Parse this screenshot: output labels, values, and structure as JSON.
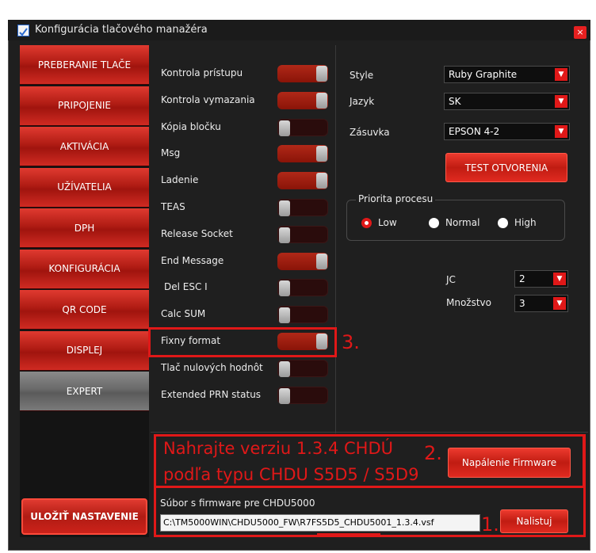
{
  "window": {
    "title": "Konfigurácia tlačového manažéra",
    "close_label": "×"
  },
  "nav": {
    "items": [
      {
        "label": "PREBERANIE TLAČE"
      },
      {
        "label": "PRIPOJENIE"
      },
      {
        "label": "AKTIVÁCIA"
      },
      {
        "label": "UŽÍVATELIA"
      },
      {
        "label": "DPH"
      },
      {
        "label": "KONFIGURÁCIA"
      },
      {
        "label": "QR CODE"
      },
      {
        "label": "DISPLEJ"
      },
      {
        "label": "EXPERT",
        "active": true
      }
    ],
    "save_label": "ULOŽIŤ NASTAVENIE"
  },
  "toggles": [
    {
      "label": "Kontrola prístupu",
      "on": true
    },
    {
      "label": "Kontrola vymazania",
      "on": true
    },
    {
      "label": "Kópia bločku",
      "on": false
    },
    {
      "label": "Msg",
      "on": true
    },
    {
      "label": "Ladenie",
      "on": true
    },
    {
      "label": "TEAS",
      "on": false
    },
    {
      "label": "Release Socket",
      "on": false
    },
    {
      "label": "End Message",
      "on": true
    },
    {
      "label": "Del ESC I",
      "on": false
    },
    {
      "label": "Calc SUM",
      "on": false
    },
    {
      "label": "Fixny format",
      "on": true
    },
    {
      "label": "Tlač nulových hodnôt",
      "on": false
    },
    {
      "label": "Extended PRN status",
      "on": false
    }
  ],
  "settings": {
    "style_label": "Style",
    "style_value": "Ruby Graphite",
    "jazyk_label": "Jazyk",
    "jazyk_value": "SK",
    "zasuvka_label": "Zásuvka",
    "zasuvka_value": "EPSON 4-2",
    "test_button": "TEST OTVORENIA",
    "priority_title": "Priorita procesu",
    "priority_options": [
      "Low",
      "Normal",
      "High"
    ],
    "priority_selected": "Low",
    "jc_label": "JC",
    "jc_value": "2",
    "mnozstvo_label": "Množstvo",
    "mnozstvo_value": "3"
  },
  "firmware": {
    "burn_button": "Napálenie Firmware",
    "file_label": "Súbor s firmware pre CHDU5000",
    "file_path": "C:\\TM5000WIN\\CHDU5000_FW\\R7FS5D5_CHDU5001_1.3.4.vsf",
    "browse_button": "Nalistuj"
  },
  "annotations": {
    "step1": "1.",
    "step2": "2.",
    "step3": "3.",
    "instruction_line1": "Nahrajte verziu 1.3.4 CHDÚ",
    "instruction_line2": "podľa typu CHDU S5D5 / S5D9"
  },
  "colors": {
    "accent": "#e01818",
    "background": "#1f1f1f",
    "nav_active": "#6a6a6a"
  }
}
